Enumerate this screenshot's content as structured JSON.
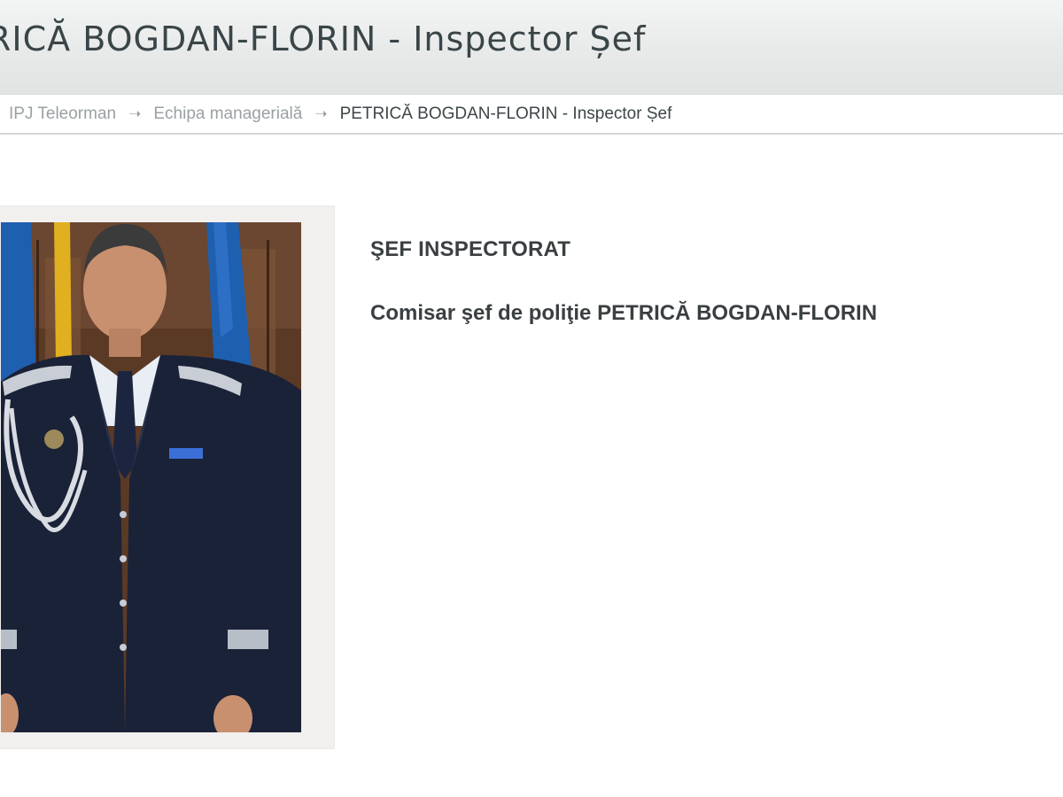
{
  "header": {
    "title": "RICĂ BOGDAN-FLORIN - Inspector Șef"
  },
  "breadcrumb": {
    "items": [
      {
        "label": "IPJ Teleorman"
      },
      {
        "label": "Echipa managerială"
      }
    ],
    "separator": "➝",
    "current": "PETRICĂ BOGDAN-FLORIN - Inspector Șef"
  },
  "profile": {
    "role": "ŞEF INSPECTORAT",
    "name_line": "Comisar şef de poliţie PETRICĂ BOGDAN-FLORIN"
  },
  "colors": {
    "title_bar": "#e8eaea",
    "title_text": "#3a4548",
    "breadcrumb_link": "#9aa1a3",
    "text_dark": "#3a3f41",
    "uniform": "#1a2238",
    "flag_blue": "#1f5fb0"
  }
}
